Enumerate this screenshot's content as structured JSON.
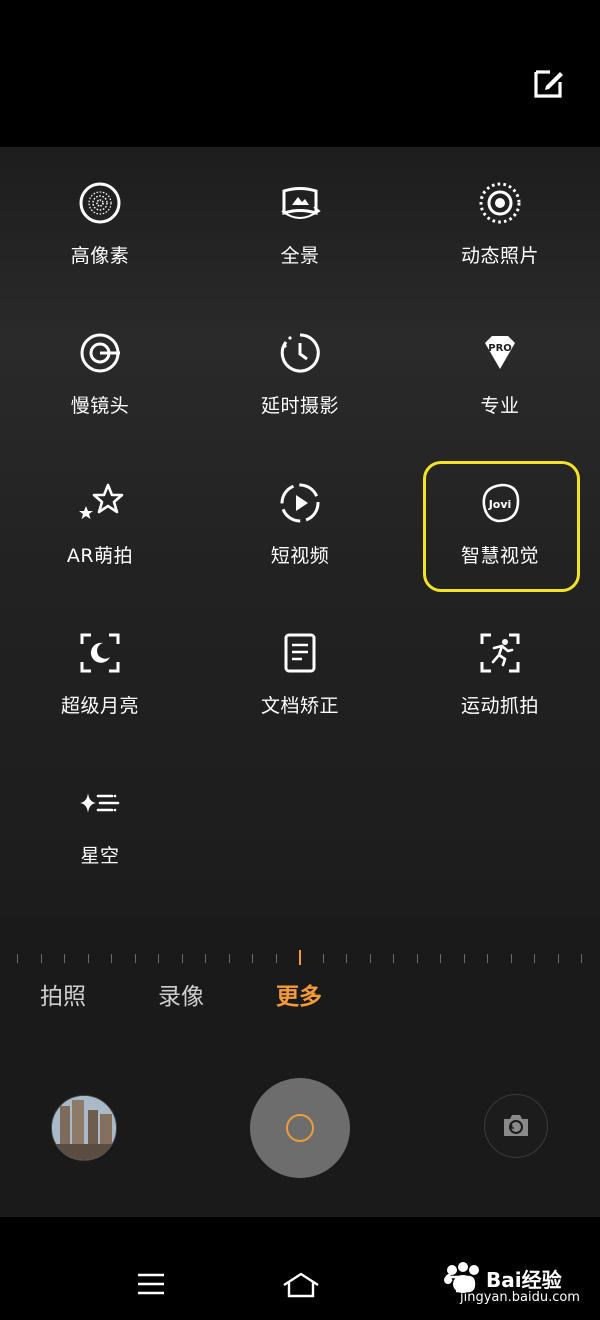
{
  "header": {
    "edit_icon": "edit-icon"
  },
  "modes": [
    {
      "label": "高像素",
      "icon": "high-pixel-icon"
    },
    {
      "label": "全景",
      "icon": "panorama-icon"
    },
    {
      "label": "动态照片",
      "icon": "live-photo-icon"
    },
    {
      "label": "慢镜头",
      "icon": "slow-motion-icon"
    },
    {
      "label": "延时摄影",
      "icon": "time-lapse-icon"
    },
    {
      "label": "专业",
      "icon": "pro-icon"
    },
    {
      "label": "AR萌拍",
      "icon": "ar-stickers-icon"
    },
    {
      "label": "短视频",
      "icon": "short-video-icon"
    },
    {
      "label": "智慧视觉",
      "icon": "jovi-vision-icon",
      "highlighted": true
    },
    {
      "label": "超级月亮",
      "icon": "super-moon-icon"
    },
    {
      "label": "文档矫正",
      "icon": "document-correction-icon"
    },
    {
      "label": "运动抓拍",
      "icon": "motion-capture-icon"
    },
    {
      "label": "星空",
      "icon": "starry-sky-icon"
    }
  ],
  "jovi_logo_text": "Jovi",
  "pro_badge_text": "PRO",
  "tabs": [
    {
      "label": "拍照"
    },
    {
      "label": "录像"
    },
    {
      "label": "更多",
      "active": true
    }
  ],
  "watermark": {
    "brand": "Bai经验",
    "url": "jingyan.baidu.com"
  },
  "colors": {
    "accent": "#f49a3a",
    "highlight": "#f2e424",
    "background": "#1d1d1d"
  }
}
